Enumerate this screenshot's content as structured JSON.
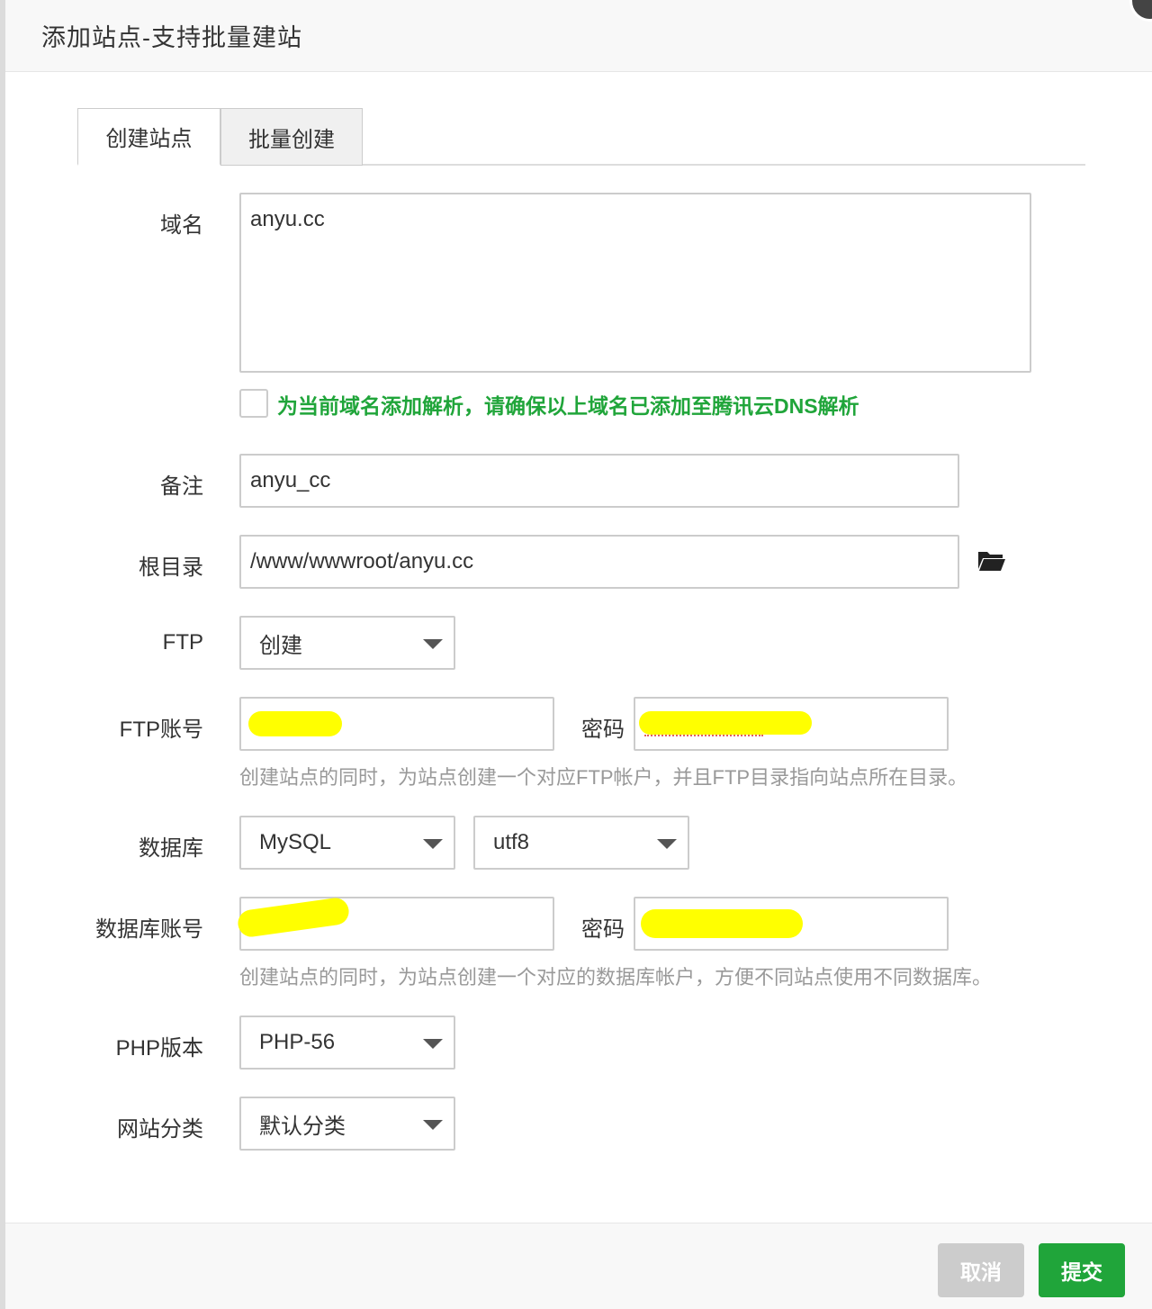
{
  "dialog": {
    "title": "添加站点-支持批量建站"
  },
  "tabs": [
    {
      "label": "创建站点",
      "active": true
    },
    {
      "label": "批量创建",
      "active": false
    }
  ],
  "form": {
    "domain": {
      "label": "域名",
      "value": "anyu.cc"
    },
    "dns_checkbox": {
      "checked": false,
      "label": "为当前域名添加解析，请确保以上域名已添加至腾讯云DNS解析"
    },
    "remark": {
      "label": "备注",
      "value": "anyu_cc"
    },
    "root_dir": {
      "label": "根目录",
      "value": "/www/wwwroot/anyu.cc",
      "icon": "folder-open-icon"
    },
    "ftp": {
      "label": "FTP",
      "selected": "创建"
    },
    "ftp_account": {
      "label": "FTP账号",
      "password_label": "密码",
      "hint": "创建站点的同时，为站点创建一个对应FTP帐户，并且FTP目录指向站点所在目录。"
    },
    "database": {
      "label": "数据库",
      "type_selected": "MySQL",
      "charset_selected": "utf8"
    },
    "db_account": {
      "label": "数据库账号",
      "password_label": "密码",
      "hint": "创建站点的同时，为站点创建一个对应的数据库帐户，方便不同站点使用不同数据库。"
    },
    "php_version": {
      "label": "PHP版本",
      "selected": "PHP-56"
    },
    "site_category": {
      "label": "网站分类",
      "selected": "默认分类"
    }
  },
  "footer": {
    "cancel_label": "取消",
    "submit_label": "提交"
  },
  "colors": {
    "accent_green": "#20a53a",
    "cancel_gray": "#cccccc",
    "redaction": "#ffff00"
  }
}
